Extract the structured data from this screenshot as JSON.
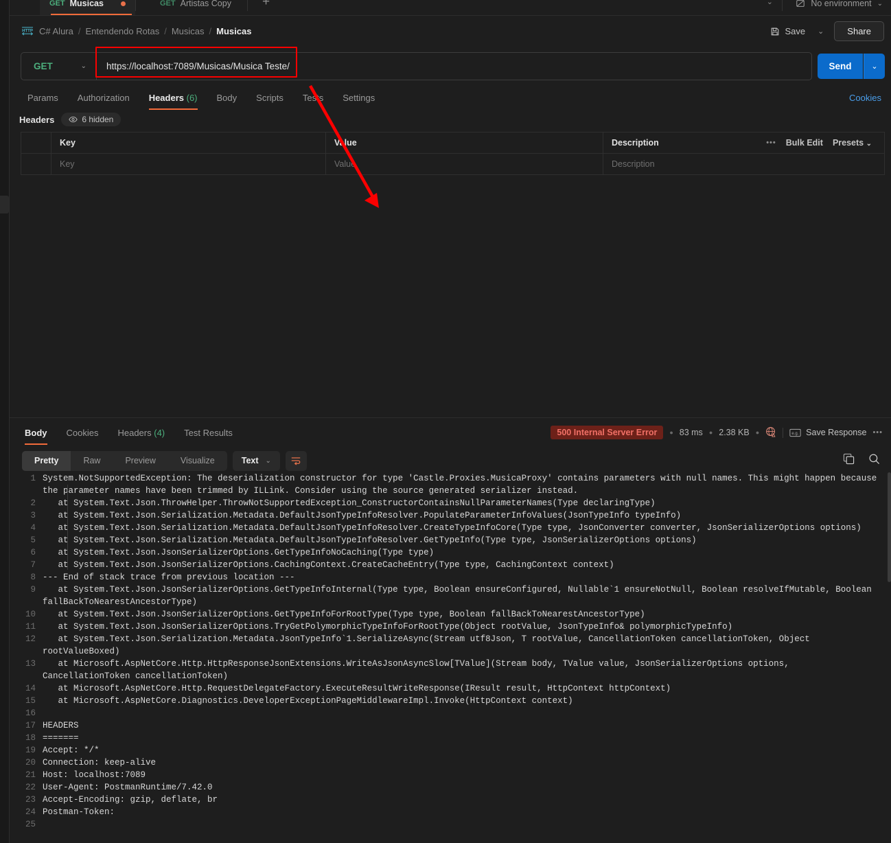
{
  "workspace": {
    "tabs": [
      {
        "method": "GET",
        "name": "Musicas",
        "active": true,
        "unsaved": true
      },
      {
        "method": "GET",
        "name": "Artistas Copy",
        "active": false,
        "unsaved": false
      }
    ],
    "new_tab_label": "+",
    "environment": "No environment"
  },
  "header": {
    "protocol_icon": "http-icon",
    "breadcrumb": [
      "C# Alura",
      "Entendendo Rotas",
      "Musicas",
      "Musicas"
    ],
    "separator": "/",
    "save_label": "Save",
    "save_caret": "⌄",
    "share_label": "Share"
  },
  "request": {
    "method": "GET",
    "method_caret": "⌄",
    "url": "https://localhost:7089/Musicas/Musica Teste/",
    "send_label": "Send",
    "send_caret": "⌄",
    "highlight_color": "#fa0000",
    "tabs": [
      {
        "label": "Params",
        "count": "",
        "active": false
      },
      {
        "label": "Authorization",
        "count": "",
        "active": false
      },
      {
        "label": "Headers",
        "count": "(6)",
        "active": true
      },
      {
        "label": "Body",
        "count": "",
        "active": false
      },
      {
        "label": "Scripts",
        "count": "",
        "active": false
      },
      {
        "label": "Tests",
        "count": "",
        "active": false
      },
      {
        "label": "Settings",
        "count": "",
        "active": false
      }
    ],
    "cookies_link": "Cookies"
  },
  "headers_panel": {
    "title": "Headers",
    "hidden_pill": "6 hidden",
    "eye_icon": "eye-icon",
    "columns": [
      "Key",
      "Value",
      "Description"
    ],
    "placeholder_row": [
      "Key",
      "Value",
      "Description"
    ],
    "actions": {
      "dots": "•••",
      "bulk_edit": "Bulk Edit",
      "presets": "Presets",
      "presets_caret": "⌄"
    }
  },
  "response": {
    "tabs": [
      {
        "label": "Body",
        "count": "",
        "active": true
      },
      {
        "label": "Cookies",
        "count": "",
        "active": false
      },
      {
        "label": "Headers",
        "count": "(4)",
        "active": false
      },
      {
        "label": "Test Results",
        "count": "",
        "active": false
      }
    ],
    "status": "500 Internal Server Error",
    "status_color": "#f07066",
    "status_bg": "#6d2119",
    "time": "83 ms",
    "size": "2.38 KB",
    "globe_icon": "globe-warning-icon",
    "save_response": "Save Response",
    "save_response_icon": "save-response-icon",
    "more_dots": "•••",
    "view_modes": [
      "Pretty",
      "Raw",
      "Preview",
      "Visualize"
    ],
    "active_view": "Pretty",
    "format": "Text",
    "format_caret": "⌄",
    "wrap_icon": "wrap-lines-icon",
    "copy_icon": "copy-icon",
    "search_icon": "search-icon"
  },
  "body_lines": [
    {
      "n": "1",
      "text": "System.NotSupportedException: The deserialization constructor for type 'Castle.Proxies.MusicaProxy' contains parameters with null names. This might happen because the parameter names have been trimmed by ILLink. Consider using the source generated serializer instead.",
      "indent": false
    },
    {
      "n": "2",
      "text": "   at System.Text.Json.ThrowHelper.ThrowNotSupportedException_ConstructorContainsNullParameterNames(Type declaringType)",
      "indent": false
    },
    {
      "n": "3",
      "text": "   at System.Text.Json.Serialization.Metadata.DefaultJsonTypeInfoResolver.PopulateParameterInfoValues(JsonTypeInfo typeInfo)",
      "indent": false
    },
    {
      "n": "4",
      "text": "   at System.Text.Json.Serialization.Metadata.DefaultJsonTypeInfoResolver.CreateTypeInfoCore(Type type, JsonConverter converter, JsonSerializerOptions options)",
      "indent": false
    },
    {
      "n": "5",
      "text": "   at System.Text.Json.Serialization.Metadata.DefaultJsonTypeInfoResolver.GetTypeInfo(Type type, JsonSerializerOptions options)",
      "indent": false
    },
    {
      "n": "6",
      "text": "   at System.Text.Json.JsonSerializerOptions.GetTypeInfoNoCaching(Type type)",
      "indent": false
    },
    {
      "n": "7",
      "text": "   at System.Text.Json.JsonSerializerOptions.CachingContext.CreateCacheEntry(Type type, CachingContext context)",
      "indent": false
    },
    {
      "n": "8",
      "text": "--- End of stack trace from previous location ---",
      "indent": false
    },
    {
      "n": "9",
      "text": "   at System.Text.Json.JsonSerializerOptions.GetTypeInfoInternal(Type type, Boolean ensureConfigured, Nullable`1 ensureNotNull, Boolean resolveIfMutable, Boolean fallBackToNearestAncestorType)",
      "indent": false
    },
    {
      "n": "10",
      "text": "   at System.Text.Json.JsonSerializerOptions.GetTypeInfoForRootType(Type type, Boolean fallBackToNearestAncestorType)",
      "indent": false
    },
    {
      "n": "11",
      "text": "   at System.Text.Json.JsonSerializerOptions.TryGetPolymorphicTypeInfoForRootType(Object rootValue, JsonTypeInfo& polymorphicTypeInfo)",
      "indent": false
    },
    {
      "n": "12",
      "text": "   at System.Text.Json.Serialization.Metadata.JsonTypeInfo`1.SerializeAsync(Stream utf8Json, T rootValue, CancellationToken cancellationToken, Object rootValueBoxed)",
      "indent": false
    },
    {
      "n": "13",
      "text": "   at Microsoft.AspNetCore.Http.HttpResponseJsonExtensions.WriteAsJsonAsyncSlow[TValue](Stream body, TValue value, JsonSerializerOptions options, CancellationToken cancellationToken)",
      "indent": false
    },
    {
      "n": "14",
      "text": "   at Microsoft.AspNetCore.Http.RequestDelegateFactory.ExecuteResultWriteResponse(IResult result, HttpContext httpContext)",
      "indent": false
    },
    {
      "n": "15",
      "text": "   at Microsoft.AspNetCore.Diagnostics.DeveloperExceptionPageMiddlewareImpl.Invoke(HttpContext context)",
      "indent": false
    },
    {
      "n": "16",
      "text": "",
      "indent": false
    },
    {
      "n": "17",
      "text": "HEADERS",
      "indent": false
    },
    {
      "n": "18",
      "text": "=======",
      "indent": false
    },
    {
      "n": "19",
      "text": "Accept: */*",
      "indent": false
    },
    {
      "n": "20",
      "text": "Connection: keep-alive",
      "indent": false
    },
    {
      "n": "21",
      "text": "Host: localhost:7089",
      "indent": false
    },
    {
      "n": "22",
      "text": "User-Agent: PostmanRuntime/7.42.0",
      "indent": false
    },
    {
      "n": "23",
      "text": "Accept-Encoding: gzip, deflate, br",
      "indent": false
    },
    {
      "n": "24",
      "text": "Postman-Token: ",
      "indent": false
    },
    {
      "n": "25",
      "text": "",
      "indent": false
    }
  ]
}
